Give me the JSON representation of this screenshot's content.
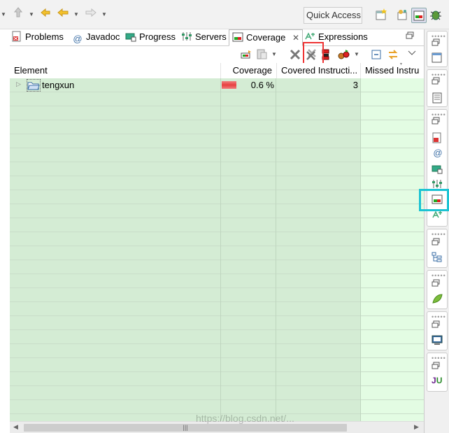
{
  "toolbar": {
    "quick_access_label": "Quick Access"
  },
  "tabs": [
    {
      "label": "Problems",
      "active": false
    },
    {
      "label": "Javadoc",
      "active": false
    },
    {
      "label": "Progress",
      "active": false
    },
    {
      "label": "Servers",
      "active": false
    },
    {
      "label": "Coverage",
      "active": true
    },
    {
      "label": "Expressions",
      "active": false
    }
  ],
  "table": {
    "columns": [
      "Element",
      "Coverage",
      "Covered Instructi...",
      "Missed Instru"
    ],
    "rows": [
      {
        "element": "tengxun",
        "coverage": "0.6 %",
        "covered_instructions": "3",
        "missed_instructions": ""
      }
    ]
  },
  "scrollbar": {
    "grip": "|||"
  },
  "colors": {
    "highlight_red": "#e33333",
    "highlight_cyan": "#1bc3d3",
    "row_green": "#d4ecd4",
    "row_light_green": "#e3fce3",
    "coverage_bar_red": "#e84040"
  },
  "icons": [
    "back-icon",
    "forward-icon",
    "open-perspective-icon",
    "debug-icon",
    "remove-session-icon",
    "remove-all-sessions-icon",
    "merge-sessions-icon",
    "relaunch-icon",
    "collapse-all-icon",
    "link-icon",
    "view-menu-icon",
    "minimize-icon",
    "maximize-icon",
    "coverage-icon",
    "problems-icon",
    "javadoc-icon",
    "progress-icon",
    "servers-icon",
    "expressions-icon",
    "junit-icon"
  ],
  "watermark": "https://blog.csdn.net/..."
}
